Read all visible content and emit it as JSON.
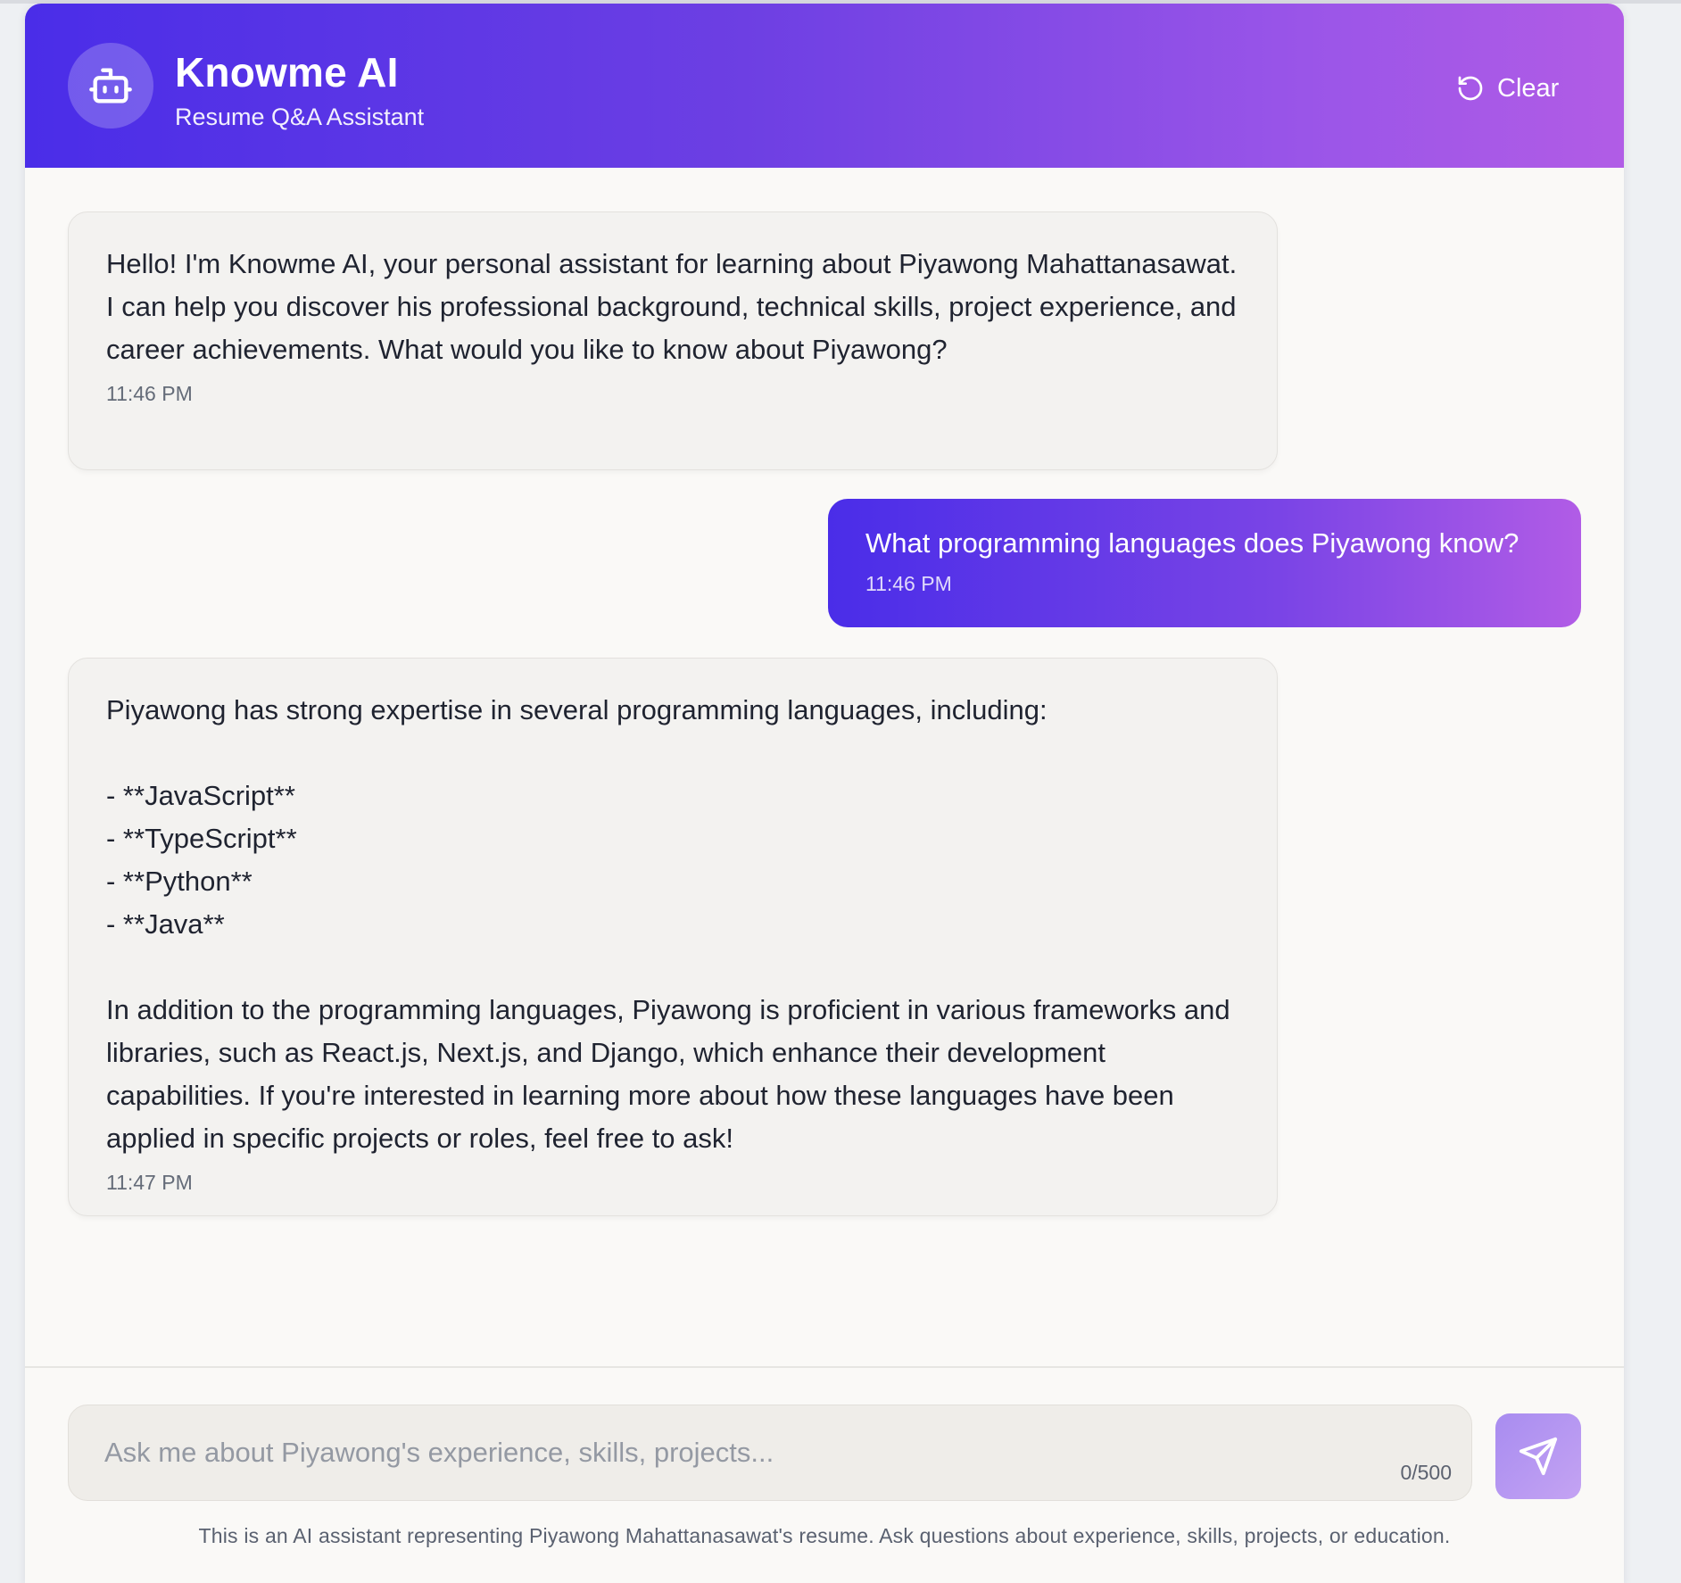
{
  "header": {
    "title": "Knowme AI",
    "subtitle": "Resume Q&A Assistant",
    "clear_label": "Clear"
  },
  "messages": [
    {
      "role": "assistant",
      "text": "Hello! I'm Knowme AI, your personal assistant for learning about Piyawong Mahattanasawat. I can help you discover his professional background, technical skills, project experience, and career achievements. What would you like to know about Piyawong?",
      "time": "11:46 PM"
    },
    {
      "role": "user",
      "text": "What programming languages does Piyawong know?",
      "time": "11:46 PM"
    },
    {
      "role": "assistant",
      "text": "Piyawong has strong expertise in several programming languages, including:\n\n- **JavaScript**\n- **TypeScript**\n- **Python**\n- **Java**\n\nIn addition to the programming languages, Piyawong is proficient in various frameworks and libraries, such as React.js, Next.js, and Django, which enhance their development capabilities. If you're interested in learning more about how these languages have been applied in specific projects or roles, feel free to ask!",
      "time": "11:47 PM"
    }
  ],
  "composer": {
    "placeholder": "Ask me about Piyawong's experience, skills, projects...",
    "value": "",
    "counter": "0/500"
  },
  "footer": {
    "disclaimer": "This is an AI assistant representing Piyawong Mahattanasawat's resume. Ask questions about experience, skills, projects, or education."
  },
  "icons": {
    "avatar": "robot-icon",
    "clear": "refresh-icon",
    "send": "send-icon"
  },
  "colors": {
    "accent_start": "#4a2de8",
    "accent_end": "#b15ce6",
    "bot_bubble": "#f3f2f0"
  }
}
